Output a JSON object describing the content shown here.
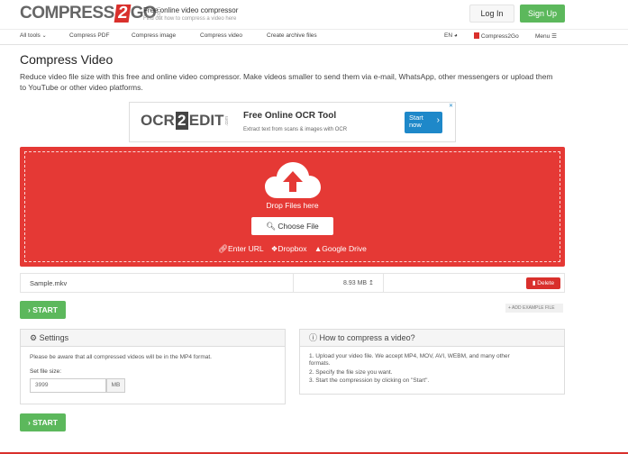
{
  "header": {
    "logo_left": "COMPRESS",
    "logo_two": "2",
    "logo_right": "GO",
    "logo_com": ".com",
    "tagline_title": "Free online video compressor",
    "tagline_sub": "Find out how to compress a video here",
    "login": "Log In",
    "signup": "Sign Up"
  },
  "nav": {
    "all_tools": "All tools",
    "compress_pdf": "Compress PDF",
    "compress_image": "Compress image",
    "compress_video": "Compress video",
    "create_archive": "Create archive files",
    "language": "EN",
    "brand": "Compress2Go",
    "menu": "Menu"
  },
  "main": {
    "title": "Compress Video",
    "description": "Reduce video file size with this free and online video compressor. Make videos smaller to send them via e-mail, WhatsApp, other messengers or upload them to YouTube or other video platforms."
  },
  "ad": {
    "logo_left": "OCR",
    "logo_two": "2",
    "logo_right": "EDIT",
    "logo_com": ".com",
    "title": "Free Online OCR Tool",
    "subtitle": "Extract text from scans & images with OCR",
    "cta_line1": "Start",
    "cta_line2": "now"
  },
  "upload": {
    "drop_text": "Drop Files here",
    "choose_file": "Choose File",
    "enter_url": "Enter URL",
    "dropbox": "Dropbox",
    "google_drive": "Google Drive"
  },
  "file": {
    "name": "Sample.mkv",
    "size": "8.93 MB",
    "delete": "Delete"
  },
  "actions": {
    "start": "START",
    "add_example": "ADD EXAMPLE FILE"
  },
  "settings": {
    "heading": "Settings",
    "note": "Please be aware that all compressed videos will be in the MP4 format.",
    "file_size_label": "Set file size:",
    "file_size_value": "3999",
    "file_size_unit": "MB"
  },
  "howto": {
    "heading": "How to compress a video?",
    "step1a": "1. Upload your video file. We accept MP4, MOV, AVI, WEBM, and many other",
    "step1b": "formats.",
    "step2": "2. Specify the file size you want.",
    "step3": "3. Start the compression by clicking on \"Start\"."
  },
  "colors": {
    "brand_red": "#e53935",
    "start_green": "#5cb85c",
    "ad_blue": "#1e88c9"
  }
}
